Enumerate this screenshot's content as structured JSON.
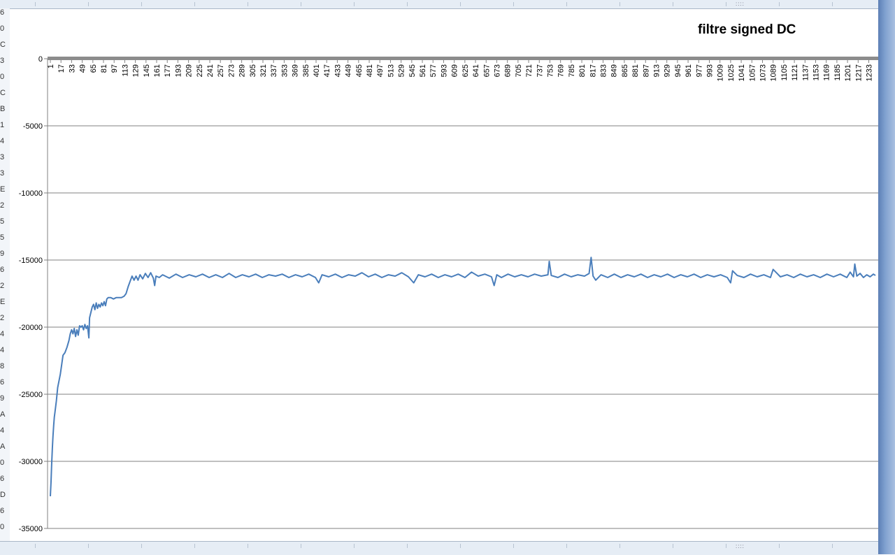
{
  "chart_data": {
    "type": "line",
    "title": "filtre signed DC",
    "xlabel": "",
    "ylabel": "",
    "ylim": [
      -35000,
      0
    ],
    "yticks": [
      0,
      -5000,
      -10000,
      -15000,
      -20000,
      -25000,
      -30000,
      -35000
    ],
    "ytick_labels": [
      "0",
      "-5000",
      "-10000",
      "-15000",
      "-20000",
      "-25000",
      "-30000",
      "-35000"
    ],
    "x_range": [
      1,
      1243
    ],
    "xtick_labels": [
      "1",
      "17",
      "33",
      "49",
      "65",
      "81",
      "97",
      "113",
      "129",
      "145",
      "161",
      "177",
      "193",
      "209",
      "225",
      "241",
      "257",
      "273",
      "289",
      "305",
      "321",
      "337",
      "353",
      "369",
      "385",
      "401",
      "417",
      "433",
      "449",
      "465",
      "481",
      "497",
      "513",
      "529",
      "545",
      "561",
      "577",
      "593",
      "609",
      "625",
      "641",
      "657",
      "673",
      "689",
      "705",
      "721",
      "737",
      "753",
      "769",
      "785",
      "801",
      "817",
      "833",
      "849",
      "865",
      "881",
      "897",
      "913",
      "929",
      "945",
      "961",
      "977",
      "993",
      "1009",
      "1025",
      "1041",
      "1057",
      "1073",
      "1089",
      "1105",
      "1121",
      "1137",
      "1153",
      "1169",
      "1185",
      "1201",
      "1217",
      "1233"
    ],
    "grid": true,
    "legend": "none",
    "series": [
      {
        "color": "#4a7ebb",
        "points": [
          [
            1,
            -32600
          ],
          [
            2,
            -31500
          ],
          [
            3,
            -30200
          ],
          [
            4,
            -29000
          ],
          [
            5,
            -28100
          ],
          [
            6,
            -27300
          ],
          [
            7,
            -26700
          ],
          [
            8,
            -26300
          ],
          [
            10,
            -25500
          ],
          [
            12,
            -24500
          ],
          [
            14,
            -24000
          ],
          [
            16,
            -23500
          ],
          [
            18,
            -22800
          ],
          [
            20,
            -22100
          ],
          [
            23,
            -21900
          ],
          [
            26,
            -21500
          ],
          [
            29,
            -21000
          ],
          [
            31,
            -20500
          ],
          [
            33,
            -20200
          ],
          [
            35,
            -20500
          ],
          [
            37,
            -20100
          ],
          [
            39,
            -20700
          ],
          [
            41,
            -20200
          ],
          [
            43,
            -20600
          ],
          [
            45,
            -19900
          ],
          [
            47,
            -20000
          ],
          [
            49,
            -19900
          ],
          [
            51,
            -20200
          ],
          [
            53,
            -19800
          ],
          [
            55,
            -20100
          ],
          [
            57,
            -19900
          ],
          [
            59,
            -20800
          ],
          [
            60,
            -19300
          ],
          [
            62,
            -18900
          ],
          [
            64,
            -18500
          ],
          [
            66,
            -18300
          ],
          [
            68,
            -18700
          ],
          [
            70,
            -18200
          ],
          [
            72,
            -18600
          ],
          [
            74,
            -18300
          ],
          [
            76,
            -18500
          ],
          [
            78,
            -18200
          ],
          [
            80,
            -18400
          ],
          [
            82,
            -18100
          ],
          [
            84,
            -18400
          ],
          [
            86,
            -17900
          ],
          [
            88,
            -17800
          ],
          [
            92,
            -17800
          ],
          [
            96,
            -17900
          ],
          [
            100,
            -17800
          ],
          [
            104,
            -17800
          ],
          [
            108,
            -17800
          ],
          [
            112,
            -17700
          ],
          [
            115,
            -17500
          ],
          [
            118,
            -17000
          ],
          [
            121,
            -16600
          ],
          [
            124,
            -16200
          ],
          [
            127,
            -16500
          ],
          [
            130,
            -16200
          ],
          [
            133,
            -16500
          ],
          [
            136,
            -16100
          ],
          [
            140,
            -16400
          ],
          [
            144,
            -16000
          ],
          [
            148,
            -16300
          ],
          [
            152,
            -15950
          ],
          [
            156,
            -16350
          ],
          [
            158,
            -16900
          ],
          [
            160,
            -16200
          ],
          [
            165,
            -16300
          ],
          [
            170,
            -16100
          ],
          [
            180,
            -16350
          ],
          [
            190,
            -16050
          ],
          [
            200,
            -16300
          ],
          [
            210,
            -16100
          ],
          [
            220,
            -16250
          ],
          [
            230,
            -16050
          ],
          [
            240,
            -16300
          ],
          [
            250,
            -16100
          ],
          [
            260,
            -16300
          ],
          [
            270,
            -16000
          ],
          [
            280,
            -16300
          ],
          [
            290,
            -16100
          ],
          [
            300,
            -16250
          ],
          [
            310,
            -16050
          ],
          [
            320,
            -16300
          ],
          [
            330,
            -16100
          ],
          [
            340,
            -16200
          ],
          [
            350,
            -16050
          ],
          [
            360,
            -16300
          ],
          [
            370,
            -16100
          ],
          [
            380,
            -16250
          ],
          [
            390,
            -16050
          ],
          [
            400,
            -16300
          ],
          [
            405,
            -16700
          ],
          [
            410,
            -16100
          ],
          [
            420,
            -16250
          ],
          [
            430,
            -16050
          ],
          [
            440,
            -16300
          ],
          [
            450,
            -16100
          ],
          [
            460,
            -16200
          ],
          [
            470,
            -15950
          ],
          [
            480,
            -16250
          ],
          [
            490,
            -16050
          ],
          [
            500,
            -16300
          ],
          [
            510,
            -16100
          ],
          [
            520,
            -16200
          ],
          [
            530,
            -15950
          ],
          [
            540,
            -16250
          ],
          [
            548,
            -16700
          ],
          [
            555,
            -16100
          ],
          [
            565,
            -16250
          ],
          [
            575,
            -16050
          ],
          [
            585,
            -16300
          ],
          [
            595,
            -16100
          ],
          [
            605,
            -16250
          ],
          [
            615,
            -16050
          ],
          [
            625,
            -16300
          ],
          [
            635,
            -15900
          ],
          [
            645,
            -16200
          ],
          [
            655,
            -16050
          ],
          [
            665,
            -16250
          ],
          [
            669,
            -16900
          ],
          [
            673,
            -16100
          ],
          [
            680,
            -16300
          ],
          [
            690,
            -16050
          ],
          [
            700,
            -16250
          ],
          [
            710,
            -16100
          ],
          [
            720,
            -16250
          ],
          [
            730,
            -16050
          ],
          [
            740,
            -16200
          ],
          [
            750,
            -16100
          ],
          [
            752,
            -15100
          ],
          [
            755,
            -16150
          ],
          [
            765,
            -16300
          ],
          [
            775,
            -16050
          ],
          [
            785,
            -16250
          ],
          [
            795,
            -16100
          ],
          [
            805,
            -16200
          ],
          [
            812,
            -16000
          ],
          [
            815,
            -14800
          ],
          [
            818,
            -16200
          ],
          [
            822,
            -16500
          ],
          [
            830,
            -16100
          ],
          [
            840,
            -16300
          ],
          [
            850,
            -16050
          ],
          [
            860,
            -16300
          ],
          [
            870,
            -16100
          ],
          [
            880,
            -16250
          ],
          [
            890,
            -16050
          ],
          [
            900,
            -16300
          ],
          [
            910,
            -16100
          ],
          [
            920,
            -16250
          ],
          [
            930,
            -16050
          ],
          [
            940,
            -16300
          ],
          [
            950,
            -16100
          ],
          [
            960,
            -16250
          ],
          [
            970,
            -16050
          ],
          [
            980,
            -16300
          ],
          [
            990,
            -16100
          ],
          [
            1000,
            -16250
          ],
          [
            1010,
            -16100
          ],
          [
            1020,
            -16300
          ],
          [
            1025,
            -16700
          ],
          [
            1028,
            -15800
          ],
          [
            1035,
            -16150
          ],
          [
            1045,
            -16300
          ],
          [
            1055,
            -16050
          ],
          [
            1065,
            -16250
          ],
          [
            1075,
            -16100
          ],
          [
            1085,
            -16300
          ],
          [
            1089,
            -15700
          ],
          [
            1095,
            -16000
          ],
          [
            1100,
            -16250
          ],
          [
            1110,
            -16100
          ],
          [
            1120,
            -16300
          ],
          [
            1130,
            -16050
          ],
          [
            1140,
            -16250
          ],
          [
            1150,
            -16100
          ],
          [
            1160,
            -16300
          ],
          [
            1170,
            -16050
          ],
          [
            1180,
            -16250
          ],
          [
            1190,
            -16050
          ],
          [
            1200,
            -16300
          ],
          [
            1205,
            -15900
          ],
          [
            1210,
            -16250
          ],
          [
            1212,
            -15300
          ],
          [
            1215,
            -16200
          ],
          [
            1220,
            -16000
          ],
          [
            1225,
            -16300
          ],
          [
            1230,
            -16100
          ],
          [
            1235,
            -16250
          ],
          [
            1240,
            -16050
          ],
          [
            1243,
            -16150
          ]
        ]
      }
    ]
  },
  "left_strip_chars": [
    "6",
    "0",
    "C",
    "3",
    "0",
    "C",
    "B",
    "1",
    "4",
    "3",
    "3",
    "E",
    "2",
    "5",
    "5",
    "9",
    "6",
    "2",
    "E",
    "2",
    "4",
    "4",
    "8",
    "6",
    "9",
    "A",
    "4",
    "A",
    "0",
    "6",
    "D",
    "6",
    "0"
  ]
}
